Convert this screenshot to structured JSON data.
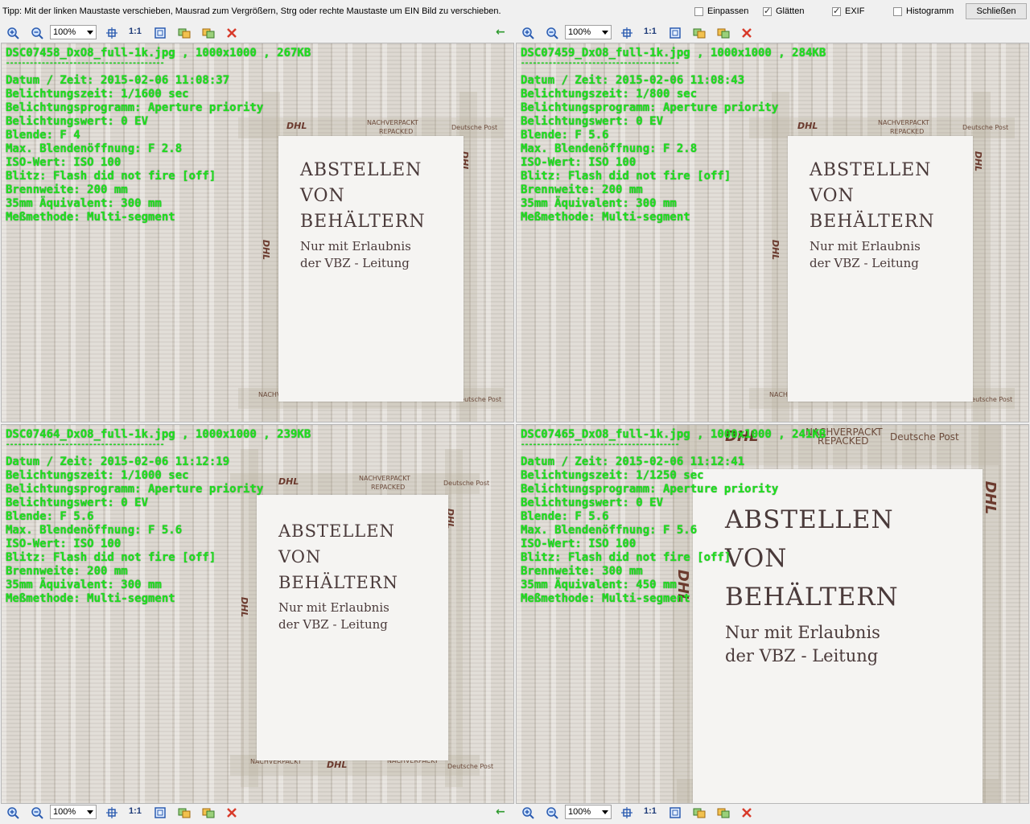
{
  "topbar": {
    "tip": "Tipp: Mit der linken Maustaste verschieben, Mausrad zum Vergrößern, Strg oder rechte Maustaste um EIN Bild zu verschieben.",
    "options": [
      {
        "label": "Einpassen",
        "checked": false
      },
      {
        "label": "Glätten",
        "checked": true
      },
      {
        "label": "EXIF",
        "checked": true
      },
      {
        "label": "Histogramm",
        "checked": false
      }
    ],
    "close_label": "Schließen"
  },
  "toolbar": {
    "zoom_value": "100%",
    "one_to_one": "1:1",
    "icons": [
      "zoom-in-icon",
      "zoom-out-icon",
      "center-icon",
      "fit-icon",
      "sync-icon",
      "swap-icon",
      "close-icon",
      "back-arrow-icon"
    ]
  },
  "paper": {
    "line1": "ABSTELLEN",
    "line2": "VON",
    "line3": "BEHÄLTERN",
    "line4": "Nur mit Erlaubnis",
    "line5": "der VBZ - Leitung"
  },
  "tape": {
    "dhl": "DHL",
    "nachverpackt": "NACHVERPACKT",
    "repacked": "REPACKED",
    "deutsche_post": "Deutsche Post"
  },
  "panels": [
    {
      "header": "DSC07458_DxO8_full-1k.jpg , 1000x1000 , 267KB",
      "separator": "----------------------------------------",
      "datum": "Datum / Zeit: 2015-02-06 11:08:37",
      "belichtungszeit": "Belichtungszeit: 1/1600 sec",
      "programm": "Belichtungsprogramm: Aperture priority",
      "wert": "Belichtungswert: 0 EV",
      "blende": "Blende: F 4",
      "max_blende": "Max. Blendenöffnung: F 2.8",
      "iso": "ISO-Wert: ISO 100",
      "blitz": "Blitz: Flash did not fire [off]",
      "brennweite": "Brennweite: 200 mm",
      "aequivalent": "35mm Äquivalent: 300 mm",
      "messmethode": "Meßmethode: Multi-segment"
    },
    {
      "header": "DSC07459_DxO8_full-1k.jpg , 1000x1000 , 284KB",
      "separator": "----------------------------------------",
      "datum": "Datum / Zeit: 2015-02-06 11:08:43",
      "belichtungszeit": "Belichtungszeit: 1/800 sec",
      "programm": "Belichtungsprogramm: Aperture priority",
      "wert": "Belichtungswert: 0 EV",
      "blende": "Blende: F 5.6",
      "max_blende": "Max. Blendenöffnung: F 2.8",
      "iso": "ISO-Wert: ISO 100",
      "blitz": "Blitz: Flash did not fire [off]",
      "brennweite": "Brennweite: 200 mm",
      "aequivalent": "35mm Äquivalent: 300 mm",
      "messmethode": "Meßmethode: Multi-segment"
    },
    {
      "header": "DSC07464_DxO8_full-1k.jpg , 1000x1000 , 239KB",
      "separator": "----------------------------------------",
      "datum": "Datum / Zeit: 2015-02-06 11:12:19",
      "belichtungszeit": "Belichtungszeit: 1/1000 sec",
      "programm": "Belichtungsprogramm: Aperture priority",
      "wert": "Belichtungswert: 0 EV",
      "blende": "Blende: F 5.6",
      "max_blende": "Max. Blendenöffnung: F 5.6",
      "iso": "ISO-Wert: ISO 100",
      "blitz": "Blitz: Flash did not fire [off]",
      "brennweite": "Brennweite: 200 mm",
      "aequivalent": "35mm Äquivalent: 300 mm",
      "messmethode": "Meßmethode: Multi-segment"
    },
    {
      "header": "DSC07465_DxO8_full-1k.jpg , 1000x1000 , 241KB",
      "separator": "----------------------------------------",
      "datum": "Datum / Zeit: 2015-02-06 11:12:41",
      "belichtungszeit": "Belichtungszeit: 1/1250 sec",
      "programm": "Belichtungsprogramm: Aperture priority",
      "wert": "Belichtungswert: 0 EV",
      "blende": "Blende: F 5.6",
      "max_blende": "Max. Blendenöffnung: F 5.6",
      "iso": "ISO-Wert: ISO 100",
      "blitz": "Blitz: Flash did not fire [off]",
      "brennweite": "Brennweite: 300 mm",
      "aequivalent": "35mm Äquivalent: 450 mm",
      "messmethode": "Meßmethode: Multi-segment"
    }
  ],
  "colors": {
    "exif_text": "#1fe01f",
    "close_icon": "#d83a2a",
    "back_arrow": "#2e9a2e"
  }
}
